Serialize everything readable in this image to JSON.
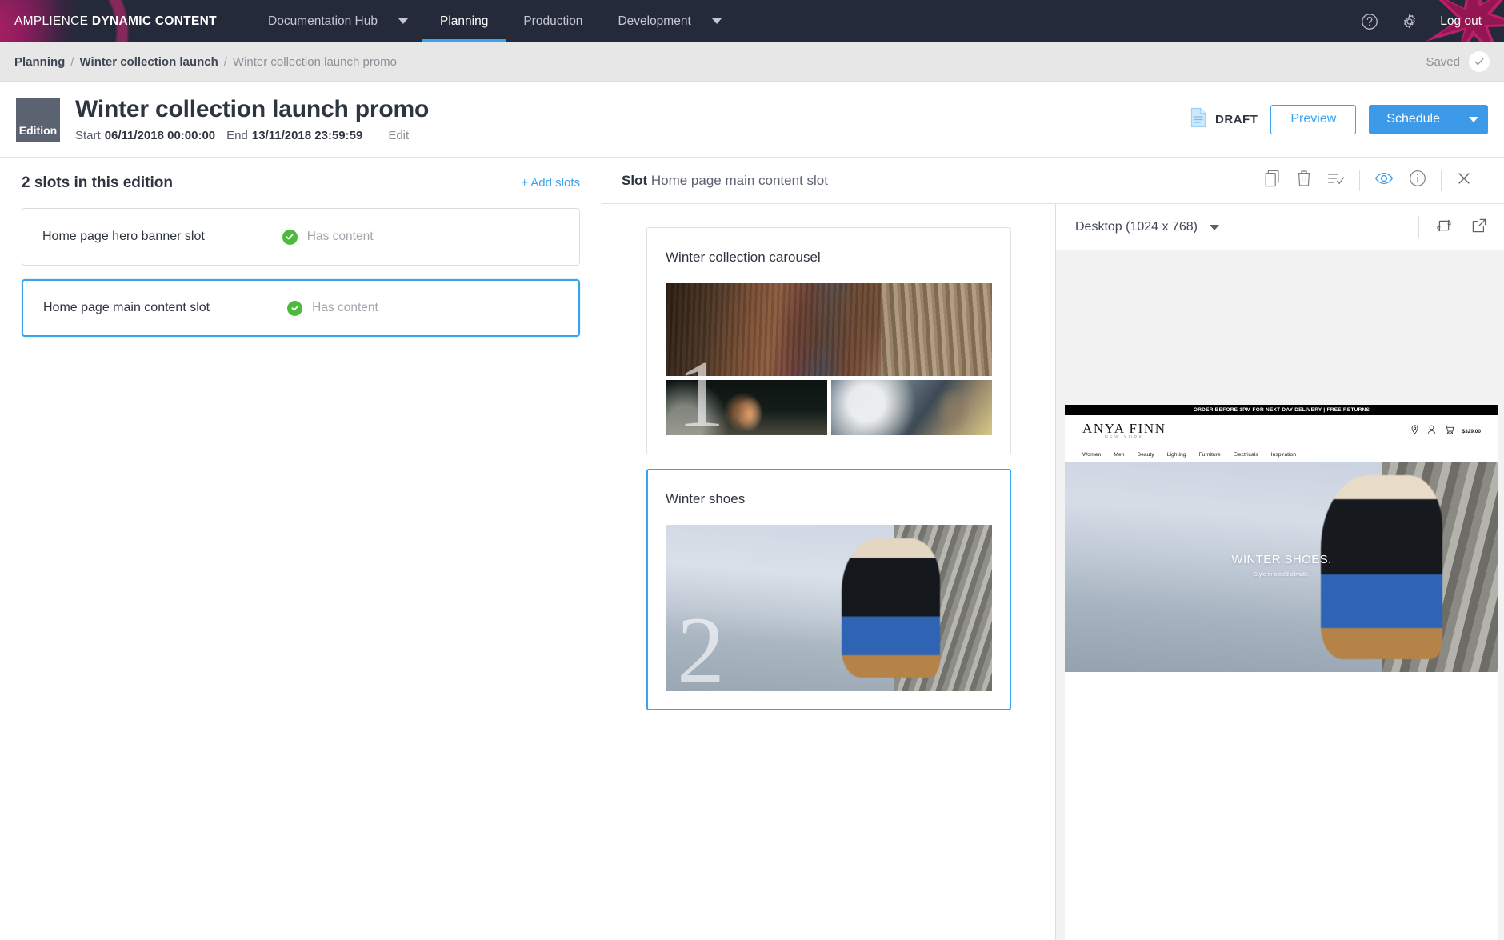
{
  "topnav": {
    "brand_prefix": "AMPLIENCE",
    "brand_bold": "DYNAMIC CONTENT",
    "items": [
      {
        "label": "Documentation Hub",
        "active": false,
        "has_caret": true
      },
      {
        "label": "Planning",
        "active": true,
        "has_caret": false
      },
      {
        "label": "Production",
        "active": false,
        "has_caret": false
      },
      {
        "label": "Development",
        "active": false,
        "has_caret": true
      }
    ],
    "help_icon": "help-circle-icon",
    "settings_icon": "gear-icon",
    "logout_label": "Log out"
  },
  "breadcrumb": {
    "root": "Planning",
    "parent": "Winter collection launch",
    "current": "Winter collection launch promo",
    "separator": "/",
    "saved_label": "Saved",
    "saved_icon": "check-icon"
  },
  "title_bar": {
    "badge": "Edition",
    "title": "Winter collection launch promo",
    "start_label": "Start",
    "start_value": "06/11/2018 00:00:00",
    "end_label": "End",
    "end_value": "13/11/2018 23:59:59",
    "edit_label": "Edit",
    "status_icon": "document-icon",
    "status_label": "DRAFT",
    "preview_label": "Preview",
    "schedule_label": "Schedule",
    "schedule_caret_icon": "chevron-down-icon",
    "accent_color": "#3d9ae8"
  },
  "slots_panel": {
    "heading": "2 slots in this edition",
    "add_label": "+ Add slots",
    "slots": [
      {
        "name": "Home page hero banner slot",
        "status": "Has content",
        "selected": false
      },
      {
        "name": "Home page main content slot",
        "status": "Has content",
        "selected": true
      }
    ]
  },
  "slot_detail": {
    "label": "Slot",
    "name": "Home page main content slot",
    "icons": [
      "copy-icon",
      "trash-icon",
      "list-check-icon",
      "visibility-icon",
      "info-icon",
      "close-icon"
    ],
    "cards": [
      {
        "title": "Winter collection carousel",
        "number": "1",
        "selected": false
      },
      {
        "title": "Winter shoes",
        "number": "2",
        "selected": true
      }
    ]
  },
  "preview": {
    "device_label": "Desktop (1024 x 768)",
    "device_caret_icon": "chevron-down-icon",
    "refresh_icon": "rotate-device-icon",
    "popout_icon": "external-link-icon",
    "site": {
      "promo_bar": "ORDER BEFORE 1PM FOR NEXT DAY DELIVERY | FREE RETURNS",
      "logo_main": "ANYA FINN",
      "logo_sub": "NEW YORK",
      "cart_total": "$329.00",
      "header_icons": [
        "location-pin-icon",
        "user-icon",
        "cart-icon"
      ],
      "nav": [
        "Women",
        "Men",
        "Beauty",
        "Lighting",
        "Furniture",
        "Electricals",
        "Inspiration"
      ],
      "hero_title": "WINTER SHOES.",
      "hero_subtitle": "Style in a cold climate."
    }
  }
}
